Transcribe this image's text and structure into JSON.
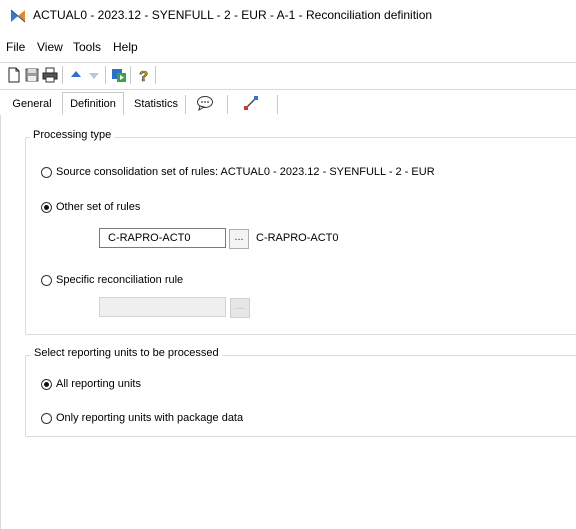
{
  "window": {
    "title": "ACTUAL0 - 2023.12 - SYENFULL - 2 - EUR - A-1 - Reconciliation definition",
    "icon": "reconciliation-app-icon"
  },
  "menu": {
    "items": [
      "File",
      "View",
      "Tools",
      "Help"
    ]
  },
  "toolbar": {
    "buttons": [
      "new-icon",
      "save-icon",
      "print-icon",
      "up-arrow-icon",
      "down-arrow-icon",
      "run-icon",
      "help-icon"
    ]
  },
  "tabs": {
    "items": [
      {
        "label": "General"
      },
      {
        "label": "Definition"
      },
      {
        "label": "Statistics"
      },
      {
        "label": "",
        "icon": "comment-icon"
      },
      {
        "label": "",
        "icon": "link-icon"
      }
    ],
    "active": "Definition"
  },
  "processing_type": {
    "legend": "Processing type",
    "source_option": "Source consolidation set of rules: ACTUAL0 - 2023.12 - SYENFULL - 2 - EUR",
    "other_option": "Other set of rules",
    "other_value": "C-RAPRO-ACT0",
    "other_description": "C-RAPRO-ACT0",
    "specific_option": "Specific reconciliation rule",
    "specific_value": "",
    "browse_label": "...",
    "selected": "other"
  },
  "reporting_units": {
    "legend": "Select reporting units to be processed",
    "all_option": "All reporting units",
    "package_option": "Only reporting units with package data",
    "selected": "all"
  }
}
